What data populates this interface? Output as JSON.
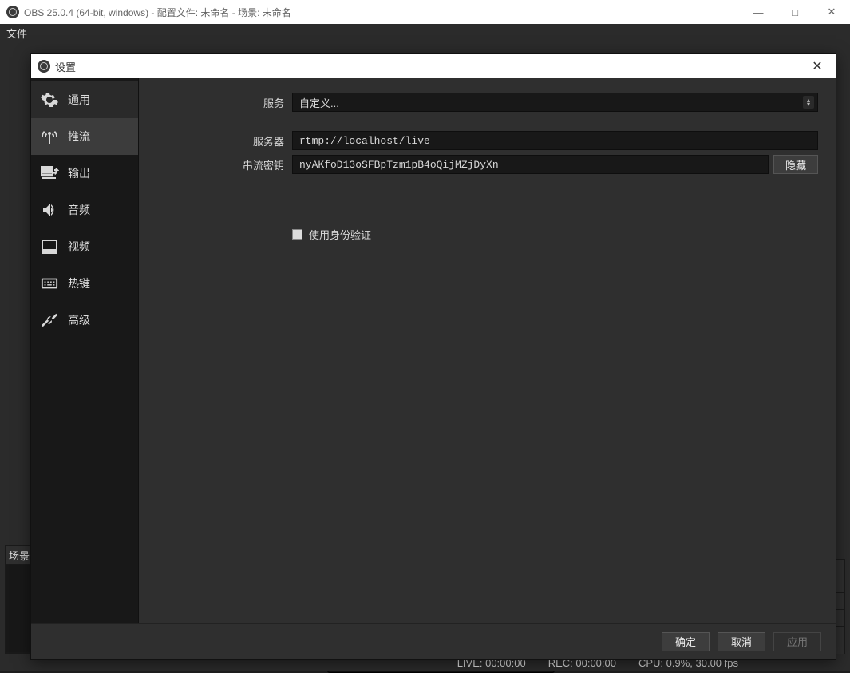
{
  "window": {
    "title": "OBS 25.0.4 (64-bit, windows) - 配置文件: 未命名 - 场景: 未命名"
  },
  "menubar": {
    "file": "文件"
  },
  "scenes_panel": {
    "header": "场景"
  },
  "statusbar": {
    "live": "LIVE: 00:00:00",
    "rec": "REC: 00:00:00",
    "cpu": "CPU: 0.9%, 30.00 fps"
  },
  "dialog": {
    "title": "设置",
    "sidebar": {
      "items": [
        {
          "label": "通用"
        },
        {
          "label": "推流"
        },
        {
          "label": "输出"
        },
        {
          "label": "音频"
        },
        {
          "label": "视频"
        },
        {
          "label": "热键"
        },
        {
          "label": "高级"
        }
      ],
      "active_index": 1
    },
    "stream": {
      "service_label": "服务",
      "service_value": "自定义...",
      "server_label": "服务器",
      "server_value": "rtmp://localhost/live",
      "key_label": "串流密钥",
      "key_value": "nyAKfoD13oSFBpTzm1pB4oQijMZjDyXn",
      "hide_btn": "隐藏",
      "auth_checkbox_label": "使用身份验证"
    },
    "footer": {
      "ok": "确定",
      "cancel": "取消",
      "apply": "应用"
    }
  }
}
